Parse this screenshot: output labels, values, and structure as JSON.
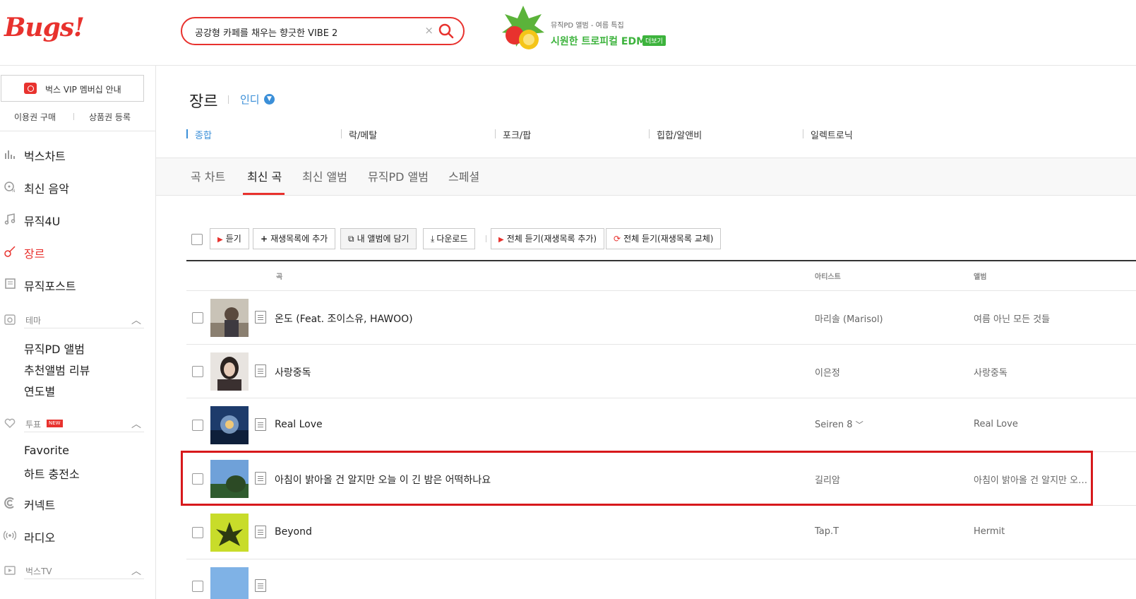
{
  "header": {
    "logo": "Bugs!",
    "search": {
      "value": "공강형 카페를 채우는 향긋한 VIBE 2"
    },
    "promo": {
      "subtitle": "뮤직PD 앨범 - 여름 특집",
      "title": "시원한 트로피컬 EDM",
      "more_label": "더보기"
    }
  },
  "sidebar": {
    "vip_label": "벅스 VIP 멤버십 안내",
    "buy_pass": "이용권 구매",
    "register_coupon": "상품권 등록",
    "menu": [
      {
        "label": "벅스차트",
        "icon": "bar-chart-icon"
      },
      {
        "label": "최신 음악",
        "icon": "new-music-icon"
      },
      {
        "label": "뮤직4U",
        "icon": "music-note-icon"
      },
      {
        "label": "장르",
        "icon": "guitar-icon"
      },
      {
        "label": "뮤직포스트",
        "icon": "post-icon"
      }
    ],
    "theme_group": {
      "label": "테마",
      "items": [
        "뮤직PD 앨범",
        "추천앨범 리뷰",
        "연도별"
      ]
    },
    "vote_group": {
      "label": "투표",
      "badge": "NEW",
      "items": [
        "Favorite",
        "하트 충전소"
      ]
    },
    "menu2": [
      {
        "label": "커넥트",
        "icon": "connect-icon"
      },
      {
        "label": "라디오",
        "icon": "radio-icon"
      }
    ],
    "tv_group": {
      "label": "벅스TV"
    }
  },
  "main": {
    "title": "장르",
    "selected_genre": "인디",
    "subgenres": [
      "종합",
      "락/메탈",
      "포크/팝",
      "힙합/알앤비",
      "일렉트로닉"
    ],
    "tabs": [
      "곡 차트",
      "최신 곡",
      "최신 앨범",
      "뮤직PD 앨범",
      "스페셜"
    ],
    "toolbar": {
      "play": "듣기",
      "add_playlist": "재생목록에 추가",
      "add_album": "내 앨범에 담기",
      "download": "다운로드",
      "play_all_add": "전체 듣기(재생목록 추가)",
      "play_all_replace": "전체 듣기(재생목록 교체)"
    },
    "columns": {
      "song": "곡",
      "artist": "아티스트",
      "album": "앨범"
    },
    "rows": [
      {
        "title": "온도 (Feat. 조이스유, HAWOO)",
        "artist": "마리솔 (Marisol)",
        "album": "여름 아닌 모든 것들"
      },
      {
        "title": "사랑중독",
        "artist": "이은정",
        "album": "사랑중독"
      },
      {
        "title": "Real Love",
        "artist": "Seiren 8",
        "album": "Real Love"
      },
      {
        "title": "아침이 밝아올 건 알지만 오늘 이 긴 밤은 어떡하나요",
        "artist": "길리암",
        "album": "아침이 밝아올 건 알지만 오…"
      },
      {
        "title": "Beyond",
        "artist": "Tap.T",
        "album": "Hermit"
      }
    ]
  },
  "colors": {
    "brand": "#e8322e",
    "accent_blue": "#3b8fd8",
    "promo_green": "#3db33d",
    "annotation_red": "#d7191c"
  }
}
